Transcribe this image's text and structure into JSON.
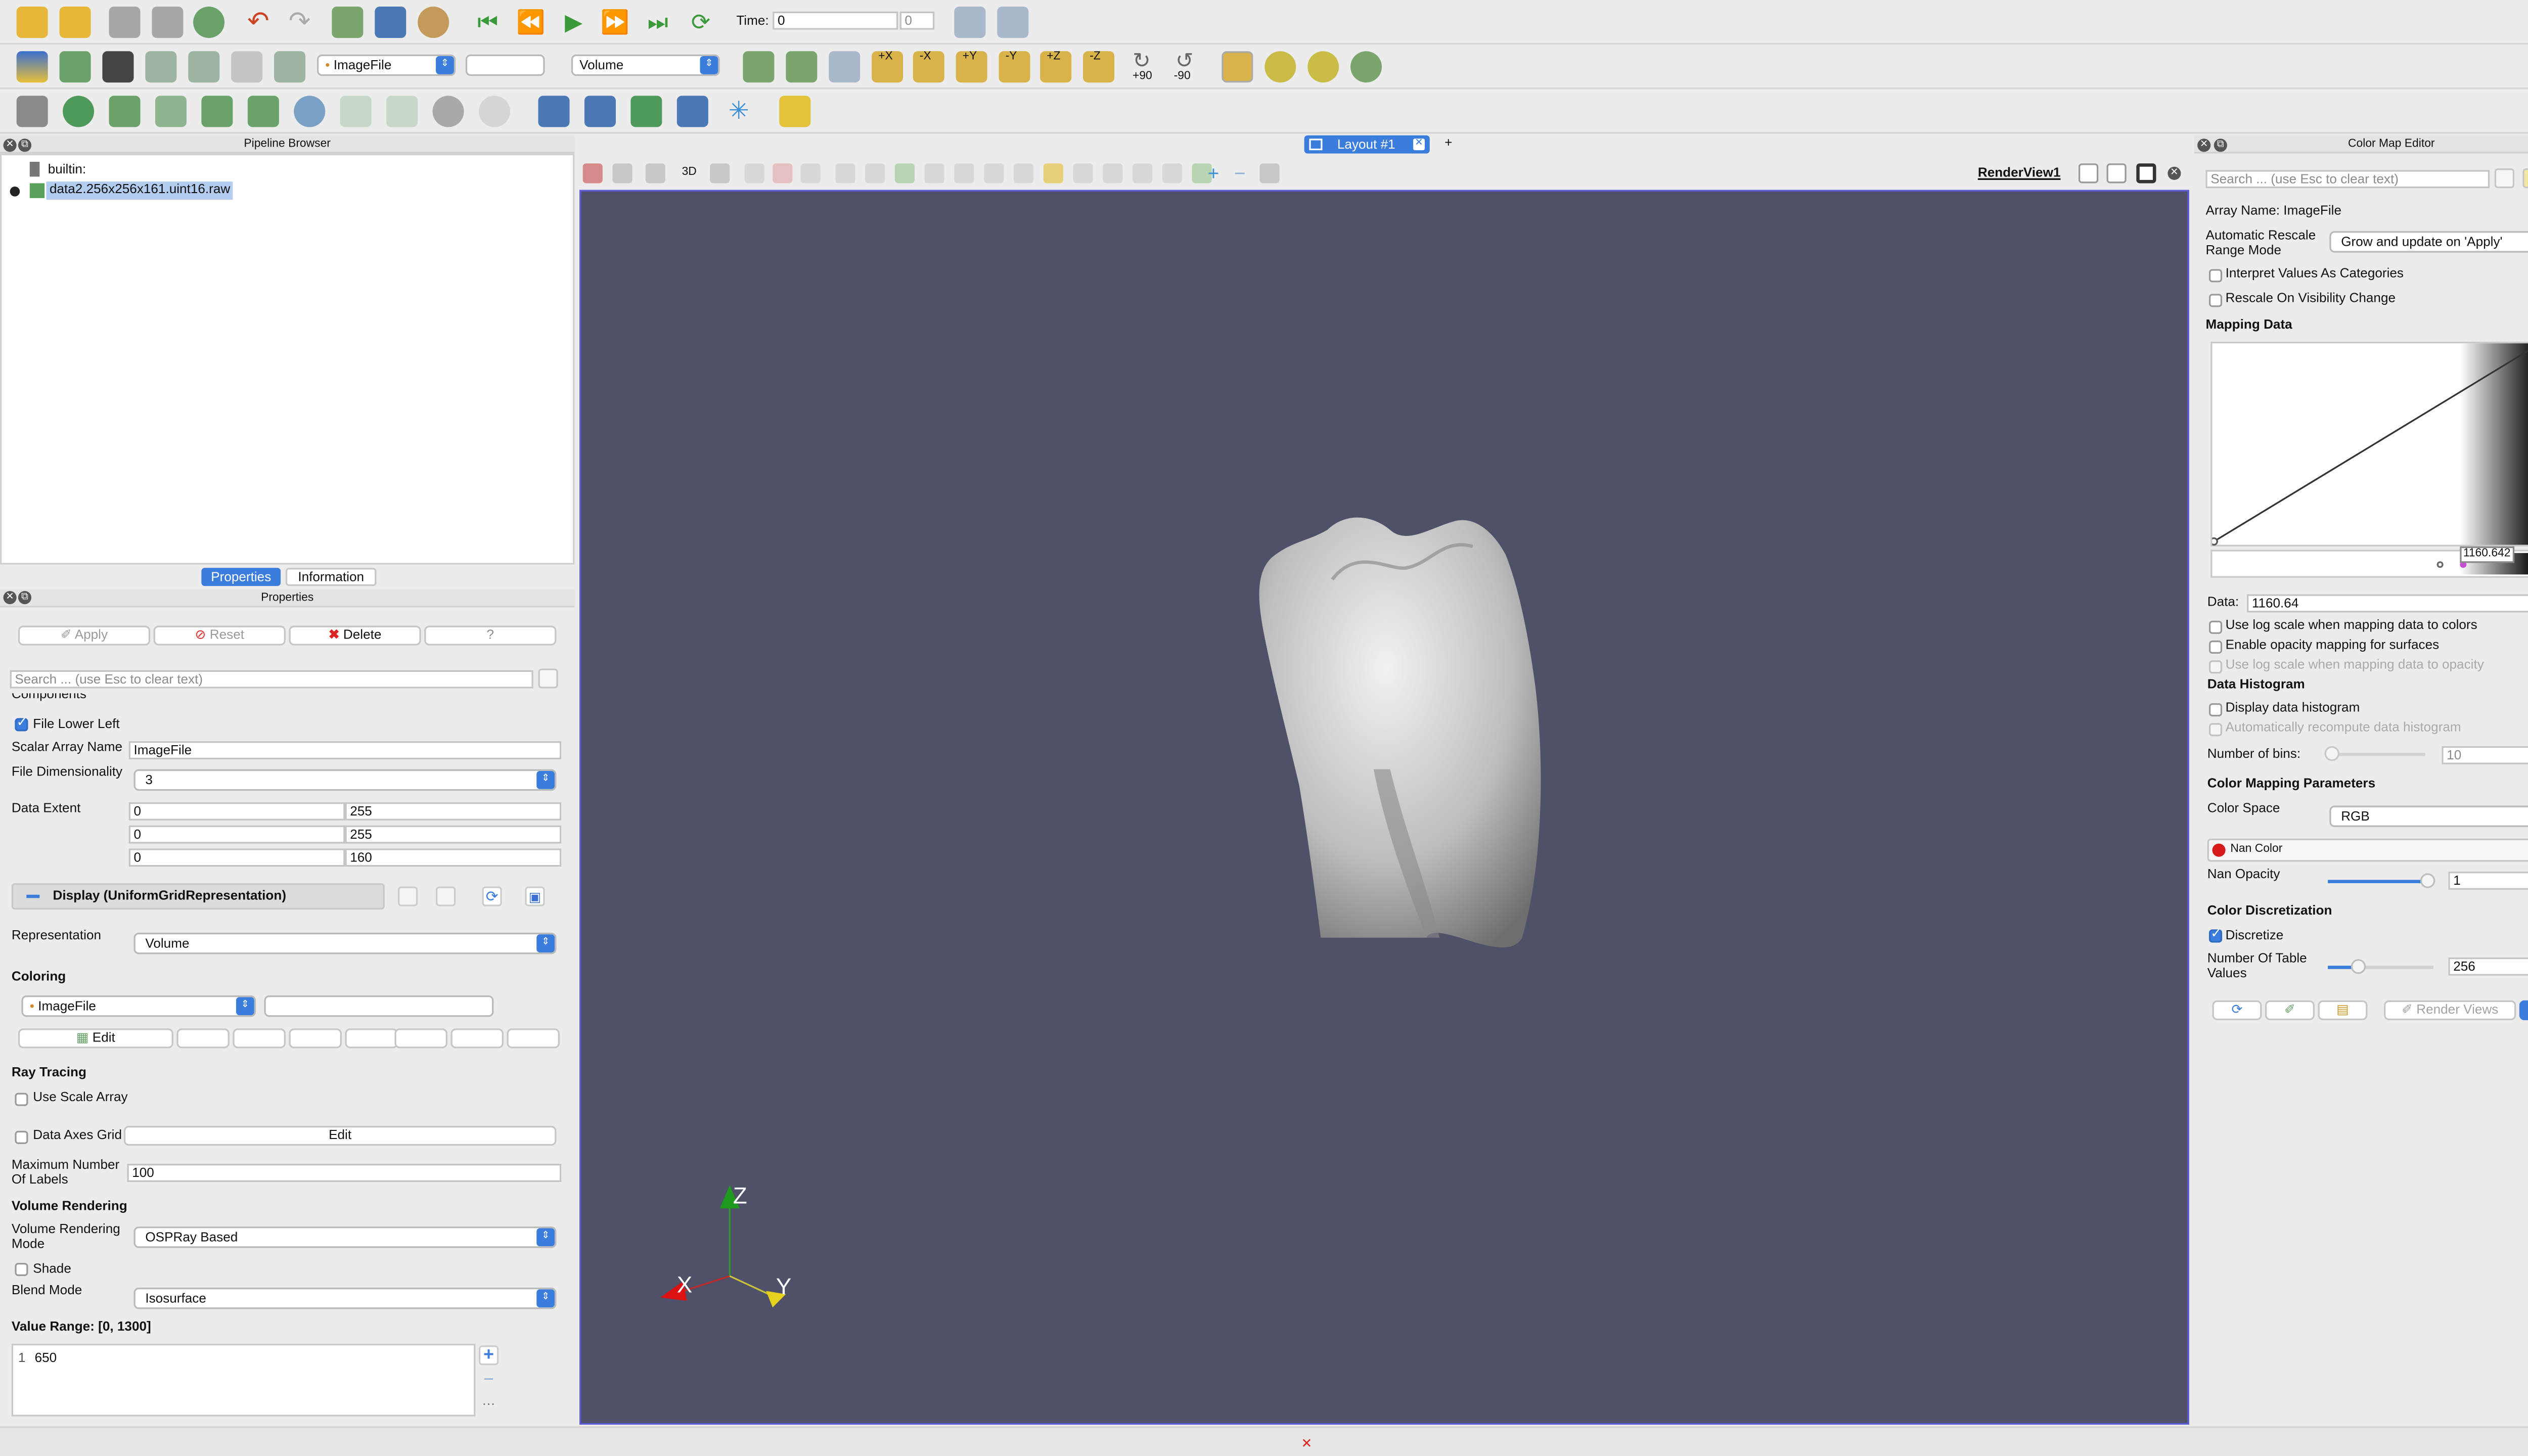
{
  "toolbar": {
    "time_label": "Time:",
    "time_value": "0",
    "time_index": "0",
    "array_select": "ImageFile",
    "component_select": "",
    "representation_select": "Volume",
    "rotate_labels": [
      "+90",
      "-90"
    ],
    "axis_labels": [
      "+X",
      "-X",
      "+Y",
      "-Y",
      "+Z",
      "-Z"
    ]
  },
  "pipeline": {
    "title": "Pipeline Browser",
    "items": [
      "builtin:",
      "data2.256x256x161.uint16.raw"
    ]
  },
  "tabs": [
    "Properties",
    "Information"
  ],
  "properties": {
    "title": "Properties",
    "apply": "Apply",
    "reset": "Reset",
    "delete": "Delete",
    "help": "?",
    "search_placeholder": "Search ... (use Esc to clear text)",
    "components": "Components",
    "file_lower_left": "File Lower Left",
    "scalar_array_name_label": "Scalar Array Name",
    "scalar_array_name": "ImageFile",
    "file_dim_label": "File Dimensionality",
    "file_dim": "3",
    "data_extent_label": "Data Extent",
    "extent": [
      [
        "0",
        "255"
      ],
      [
        "0",
        "255"
      ],
      [
        "0",
        "160"
      ]
    ],
    "display_header": "Display (UniformGridRepresentation)",
    "representation_label": "Representation",
    "representation": "Volume",
    "coloring_label": "Coloring",
    "coloring_array": "ImageFile",
    "edit": "Edit",
    "ray_tracing": "Ray Tracing",
    "use_scale_array": "Use Scale Array",
    "data_axes_grid": "Data Axes Grid",
    "data_axes_edit": "Edit",
    "max_labels_label": "Maximum Number Of Labels",
    "max_labels": "100",
    "volume_rendering": "Volume Rendering",
    "vr_mode_label": "Volume Rendering Mode",
    "vr_mode": "OSPRay Based",
    "shade": "Shade",
    "blend_mode_label": "Blend Mode",
    "blend_mode": "Isosurface",
    "value_range": "Value Range: [0, 1300]",
    "iso_index": "1",
    "iso_value": "650"
  },
  "view": {
    "layout_tab": "Layout #1",
    "add_tab": "+",
    "render_view": "RenderView1",
    "tb_3d": "3D",
    "axes": {
      "x": "X",
      "y": "Y",
      "z": "Z"
    }
  },
  "cme": {
    "title": "Color Map Editor",
    "search_placeholder": "Search ... (use Esc to clear text)",
    "array_name": "Array Name: ImageFile",
    "auto_rescale_label": "Automatic Rescale Range Mode",
    "auto_rescale": "Grow and update on 'Apply'",
    "interpret_categories": "Interpret Values As Categories",
    "rescale_visibility": "Rescale On Visibility Change",
    "mapping_data": "Mapping Data",
    "marker_value": "1160.642",
    "data_label": "Data:",
    "data_value": "1160.64",
    "log_colors": "Use log scale when mapping data to colors",
    "opacity_surfaces": "Enable opacity mapping for surfaces",
    "log_opacity": "Use log scale when mapping data to opacity",
    "data_histogram": "Data Histogram",
    "display_histogram": "Display data histogram",
    "auto_recompute": "Automatically recompute data histogram",
    "num_bins_label": "Number of bins:",
    "num_bins": "10",
    "color_mapping_params": "Color Mapping Parameters",
    "color_space_label": "Color Space",
    "color_space": "RGB",
    "nan_color": "Nan Color",
    "nan_opacity_label": "Nan Opacity",
    "nan_opacity": "1",
    "color_discretization": "Color Discretization",
    "discretize": "Discretize",
    "num_table_label": "Number Of Table Values",
    "num_table": "256",
    "render_views": "Render Views"
  },
  "colors": {
    "view_bg": "#4f5169",
    "accent": "#3b7ddd",
    "selection": "#b3cdf0"
  },
  "status": {
    "close": "✕"
  }
}
